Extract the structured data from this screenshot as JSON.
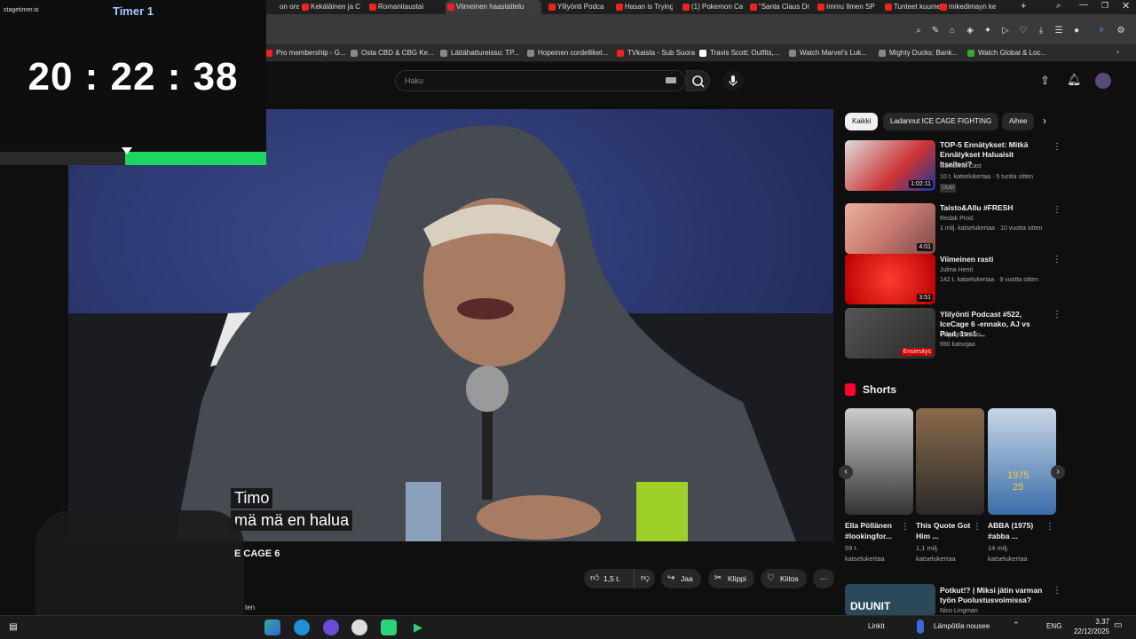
{
  "browser": {
    "tabs": [
      "on ons",
      "Kekäläinen ja C",
      "Romanitaustai",
      "Viimeinen haastattelu",
      "Ylilyönti Podca",
      "Hasan is Trying",
      "(1) Pokemon Ca",
      "\"Santa Claus Dr",
      "Immu Ilmen SP",
      "Tunteet kuume",
      "mikedimayn ke"
    ],
    "bookmarks": [
      "Pro membership - G...",
      "Osta CBD & CBG Ke...",
      "Lättähattureissu: TP...",
      "Hopeinen cordelliket...",
      "TVkaista - Sub Suora",
      "Travis Scott: Outfits,...",
      "Watch Marvel's Luk...",
      "Mighty Ducks: Bank...",
      "Watch Global & Loc..."
    ]
  },
  "timer": {
    "logo": "stagetimer.io",
    "title": "Timer 1",
    "clock": "20 : 22 : 38",
    "progress": 0.53
  },
  "youtube": {
    "search_placeholder": "Haku",
    "subtitle_lines": [
      "Timo",
      "mä mä en halua"
    ],
    "video_title": "E CAGE 6",
    "channel_snippet": "ten",
    "actions": {
      "like": "1,5 t.",
      "share": "Jaa",
      "clip": "Klippi",
      "thanks": "Kiitos"
    },
    "chips": [
      "Kaikki",
      "Ladannut ICE CAGE FIGHTING",
      "Aihee"
    ],
    "recommended": [
      {
        "title": "TOP-5 Ennätykset: Mitkä Ennätykset Haluaisit Itsellesi?",
        "channel": "Gamblers Cast",
        "meta": "10 t. katselukertaa · 5 tuntia sitten",
        "badge": "Uusi",
        "duration": "1:02:11"
      },
      {
        "title": "Taisto&Allu #FRESH",
        "channel": "Redak Prod.",
        "meta": "1 milj. katselukertaa · 10 vuotta sitten",
        "badge": "",
        "duration": "4:01"
      },
      {
        "title": "Viimeinen rasti",
        "channel": "Julma Henri",
        "meta": "142 t. katselukertaa · 9 vuotta sitten",
        "badge": "",
        "duration": "3:51"
      },
      {
        "title": "Ylilyönti Podcast #522, IceCage 6 -ennako, AJ vs Paul, 1vs1 ...",
        "channel": "Ylilyönti Studio",
        "meta": "690 katsojaa",
        "badge": "Ensiesitys",
        "duration": ""
      }
    ],
    "shorts_heading": "Shorts",
    "shorts": [
      {
        "title": "Ella Pöllänen #lookingfor...",
        "meta1": "59 t.",
        "meta2": "katselukertaa"
      },
      {
        "title": "This Quote Got Him ...",
        "meta1": "1,1 milj.",
        "meta2": "katselukertaa"
      },
      {
        "title": "ABBA (1975) #abba ...",
        "meta1": "14 milj.",
        "meta2": "katselukertaa"
      }
    ],
    "short_overlay": "1975\n25",
    "bottom_rec": {
      "title": "Potkut!? | Miksi jätin varman työn Puolustusvoimissa?",
      "channel": "Nico Lingman",
      "duration_label": "DUUNIT"
    }
  },
  "taskbar": {
    "links": "Linkit",
    "weather": "Lämpötila nousee",
    "lang": "ENG",
    "time": "3.37",
    "date": "22/12/2025"
  },
  "colors": {
    "timer_fill": "#1ed65f",
    "accent": "#ff0033"
  }
}
